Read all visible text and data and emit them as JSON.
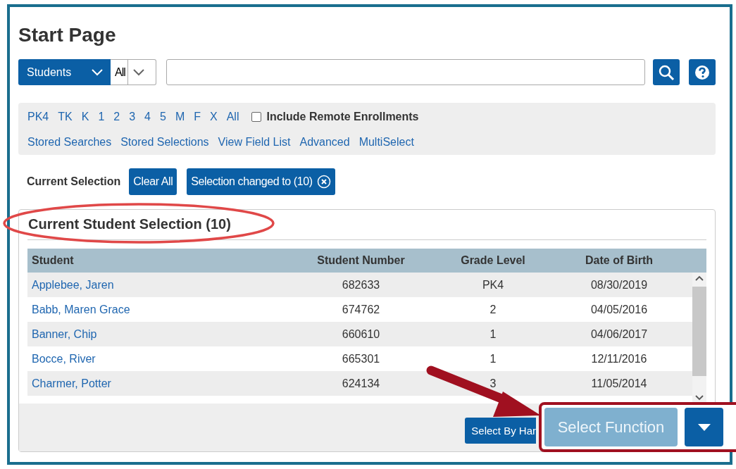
{
  "page": {
    "title": "Start Page"
  },
  "search": {
    "scope": "Students",
    "filter": "All"
  },
  "grade_links": [
    "PK4",
    "TK",
    "K",
    "1",
    "2",
    "3",
    "4",
    "5",
    "M",
    "F",
    "X",
    "All"
  ],
  "include_remote": {
    "label": "Include Remote Enrollments",
    "checked": false
  },
  "search_links": [
    "Stored Searches",
    "Stored Selections",
    "View Field List",
    "Advanced",
    "MultiSelect"
  ],
  "current_selection": {
    "label": "Current Selection",
    "clear_button": "Clear All",
    "chip": "Selection changed to (10)"
  },
  "selection_panel": {
    "title": "Current Student Selection (10)",
    "table": {
      "columns": [
        "Student",
        "Student Number",
        "Grade Level",
        "Date of Birth"
      ],
      "rows": [
        {
          "student": "Applebee, Jaren",
          "number": "682633",
          "grade": "PK4",
          "dob": "08/30/2019"
        },
        {
          "student": "Babb, Maren Grace",
          "number": "674762",
          "grade": "2",
          "dob": "04/05/2016"
        },
        {
          "student": "Banner, Chip",
          "number": "660610",
          "grade": "1",
          "dob": "04/06/2017"
        },
        {
          "student": "Bocce, River",
          "number": "665301",
          "grade": "1",
          "dob": "12/11/2016"
        },
        {
          "student": "Charmer, Potter",
          "number": "624134",
          "grade": "3",
          "dob": "11/05/2014"
        }
      ]
    },
    "select_by_hand": "Select By Har",
    "select_function": "Select Function"
  }
}
